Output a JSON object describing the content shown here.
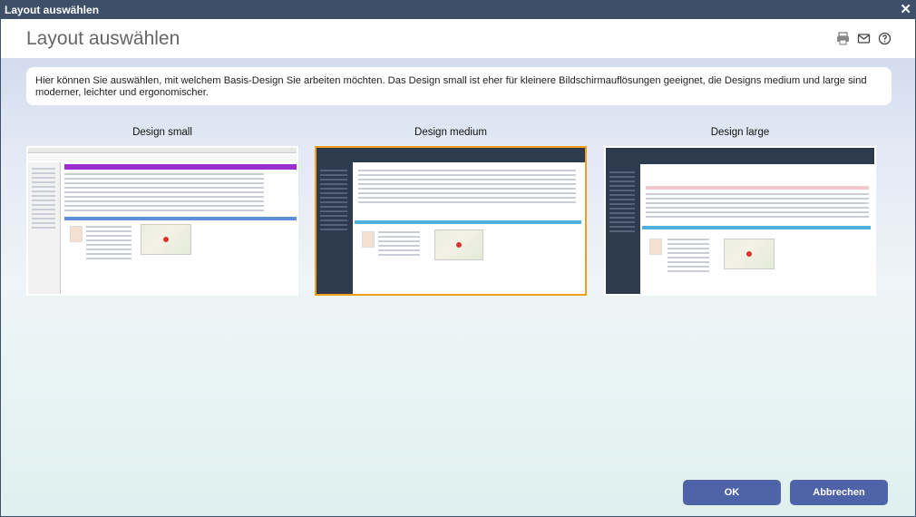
{
  "window": {
    "title": "Layout auswählen",
    "close_glyph": "✕"
  },
  "header": {
    "title": "Layout auswählen"
  },
  "info": {
    "text": "Hier können Sie auswählen, mit welchem Basis-Design Sie arbeiten möchten. Das Design small ist eher für kleinere Bildschirmauflösungen geeignet, die Designs medium und large sind moderner, leichter und ergonomischer."
  },
  "designs": [
    {
      "label": "Design small",
      "selected": false
    },
    {
      "label": "Design medium",
      "selected": true
    },
    {
      "label": "Design large",
      "selected": false
    }
  ],
  "buttons": {
    "ok": "OK",
    "cancel": "Abbrechen"
  },
  "colors": {
    "titlebar": "#3e4f6a",
    "button": "#4f63a8",
    "selection": "#f0a020",
    "small_accent": "#9b2fd0",
    "dark_sidebar": "#2e3a4d"
  }
}
